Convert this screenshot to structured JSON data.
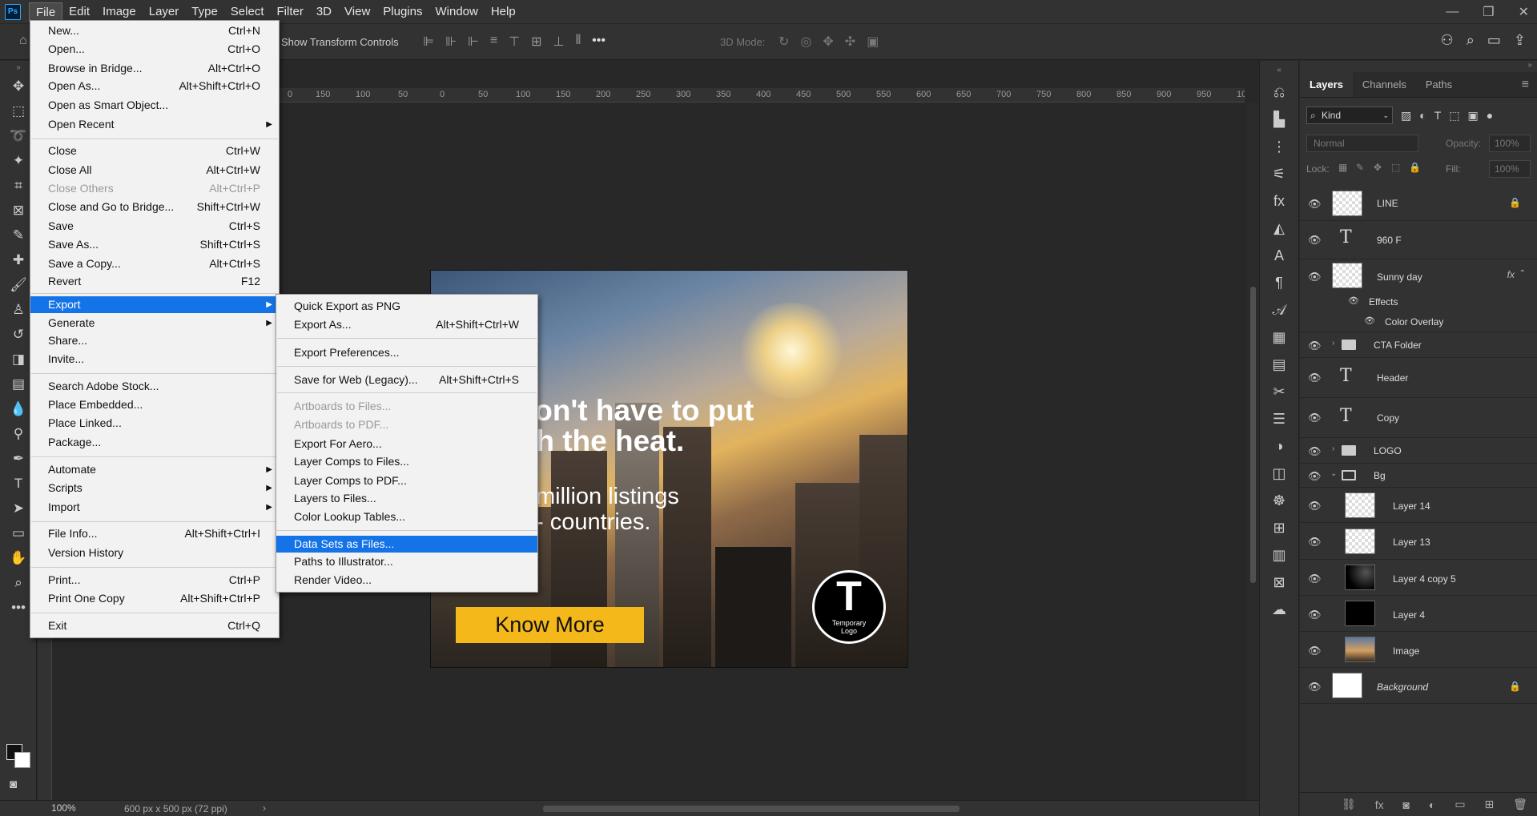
{
  "menubar": {
    "app_icon": "Ps",
    "items": [
      "File",
      "Edit",
      "Image",
      "Layer",
      "Type",
      "Select",
      "Filter",
      "3D",
      "View",
      "Plugins",
      "Window",
      "Help"
    ]
  },
  "options": {
    "show_transform": "Show Transform Controls",
    "mode_3d": "3D Mode:"
  },
  "file_menu": [
    {
      "label": "New...",
      "shortcut": "Ctrl+N"
    },
    {
      "label": "Open...",
      "shortcut": "Ctrl+O"
    },
    {
      "label": "Browse in Bridge...",
      "shortcut": "Alt+Ctrl+O"
    },
    {
      "label": "Open As...",
      "shortcut": "Alt+Shift+Ctrl+O"
    },
    {
      "label": "Open as Smart Object...",
      "shortcut": ""
    },
    {
      "label": "Open Recent",
      "shortcut": ""
    },
    {
      "label": "Close",
      "shortcut": "Ctrl+W"
    },
    {
      "label": "Close All",
      "shortcut": "Alt+Ctrl+W"
    },
    {
      "label": "Close Others",
      "shortcut": "Alt+Ctrl+P"
    },
    {
      "label": "Close and Go to Bridge...",
      "shortcut": "Shift+Ctrl+W"
    },
    {
      "label": "Save",
      "shortcut": "Ctrl+S"
    },
    {
      "label": "Save As...",
      "shortcut": "Shift+Ctrl+S"
    },
    {
      "label": "Save a Copy...",
      "shortcut": "Alt+Ctrl+S"
    },
    {
      "label": "Revert",
      "shortcut": "F12"
    },
    {
      "label": "Export",
      "shortcut": ""
    },
    {
      "label": "Generate",
      "shortcut": ""
    },
    {
      "label": "Share...",
      "shortcut": ""
    },
    {
      "label": "Invite...",
      "shortcut": ""
    },
    {
      "label": "Search Adobe Stock...",
      "shortcut": ""
    },
    {
      "label": "Place Embedded...",
      "shortcut": ""
    },
    {
      "label": "Place Linked...",
      "shortcut": ""
    },
    {
      "label": "Package...",
      "shortcut": ""
    },
    {
      "label": "Automate",
      "shortcut": ""
    },
    {
      "label": "Scripts",
      "shortcut": ""
    },
    {
      "label": "Import",
      "shortcut": ""
    },
    {
      "label": "File Info...",
      "shortcut": "Alt+Shift+Ctrl+I"
    },
    {
      "label": "Version History",
      "shortcut": ""
    },
    {
      "label": "Print...",
      "shortcut": "Ctrl+P"
    },
    {
      "label": "Print One Copy",
      "shortcut": "Alt+Shift+Ctrl+P"
    },
    {
      "label": "Exit",
      "shortcut": "Ctrl+Q"
    }
  ],
  "export_menu": [
    {
      "label": "Quick Export as PNG",
      "shortcut": ""
    },
    {
      "label": "Export As...",
      "shortcut": "Alt+Shift+Ctrl+W"
    },
    {
      "label": "Export Preferences...",
      "shortcut": ""
    },
    {
      "label": "Save for Web (Legacy)...",
      "shortcut": "Alt+Shift+Ctrl+S"
    },
    {
      "label": "Artboards to Files...",
      "shortcut": ""
    },
    {
      "label": "Artboards to PDF...",
      "shortcut": ""
    },
    {
      "label": "Export For Aero...",
      "shortcut": ""
    },
    {
      "label": "Layer Comps to Files...",
      "shortcut": ""
    },
    {
      "label": "Layer Comps to PDF...",
      "shortcut": ""
    },
    {
      "label": "Layers to Files...",
      "shortcut": ""
    },
    {
      "label": "Color Lookup Tables...",
      "shortcut": ""
    },
    {
      "label": "Data Sets as Files...",
      "shortcut": ""
    },
    {
      "label": "Paths to Illustrator...",
      "shortcut": ""
    },
    {
      "label": "Render Video...",
      "shortcut": ""
    }
  ],
  "ruler": [
    "0",
    "150",
    "100",
    "50",
    "0",
    "50",
    "100",
    "150",
    "200",
    "250",
    "300",
    "350",
    "400",
    "450",
    "500",
    "550",
    "600",
    "650",
    "700",
    "750",
    "800",
    "850",
    "900",
    "950",
    "10"
  ],
  "canvas": {
    "headline_1": "lon't have to put",
    "headline_2": "th the heat.",
    "sub_1": "million listings",
    "sub_2": "- countries.",
    "cta": "Know More",
    "logo_letter": "T",
    "logo_sub_1": "Temporary",
    "logo_sub_2": "Logo"
  },
  "status": {
    "zoom": "100%",
    "doc_info": "600 px x 500 px (72 ppi)"
  },
  "layers_panel": {
    "tabs": [
      "Layers",
      "Channels",
      "Paths"
    ],
    "kind": "Kind",
    "blend": "Normal",
    "opacity_label": "Opacity:",
    "opacity_value": "100%",
    "lock_label": "Lock:",
    "fill_label": "Fill:",
    "fill_value": "100%",
    "layers": [
      "LINE",
      "960 F",
      "Sunny day",
      "Effects",
      "Color Overlay",
      "CTA Folder",
      "Header",
      "Copy",
      "LOGO",
      "Bg",
      "Layer 14",
      "Layer 13",
      "Layer 4 copy 5",
      "Layer 4",
      "Image",
      "Background"
    ]
  }
}
